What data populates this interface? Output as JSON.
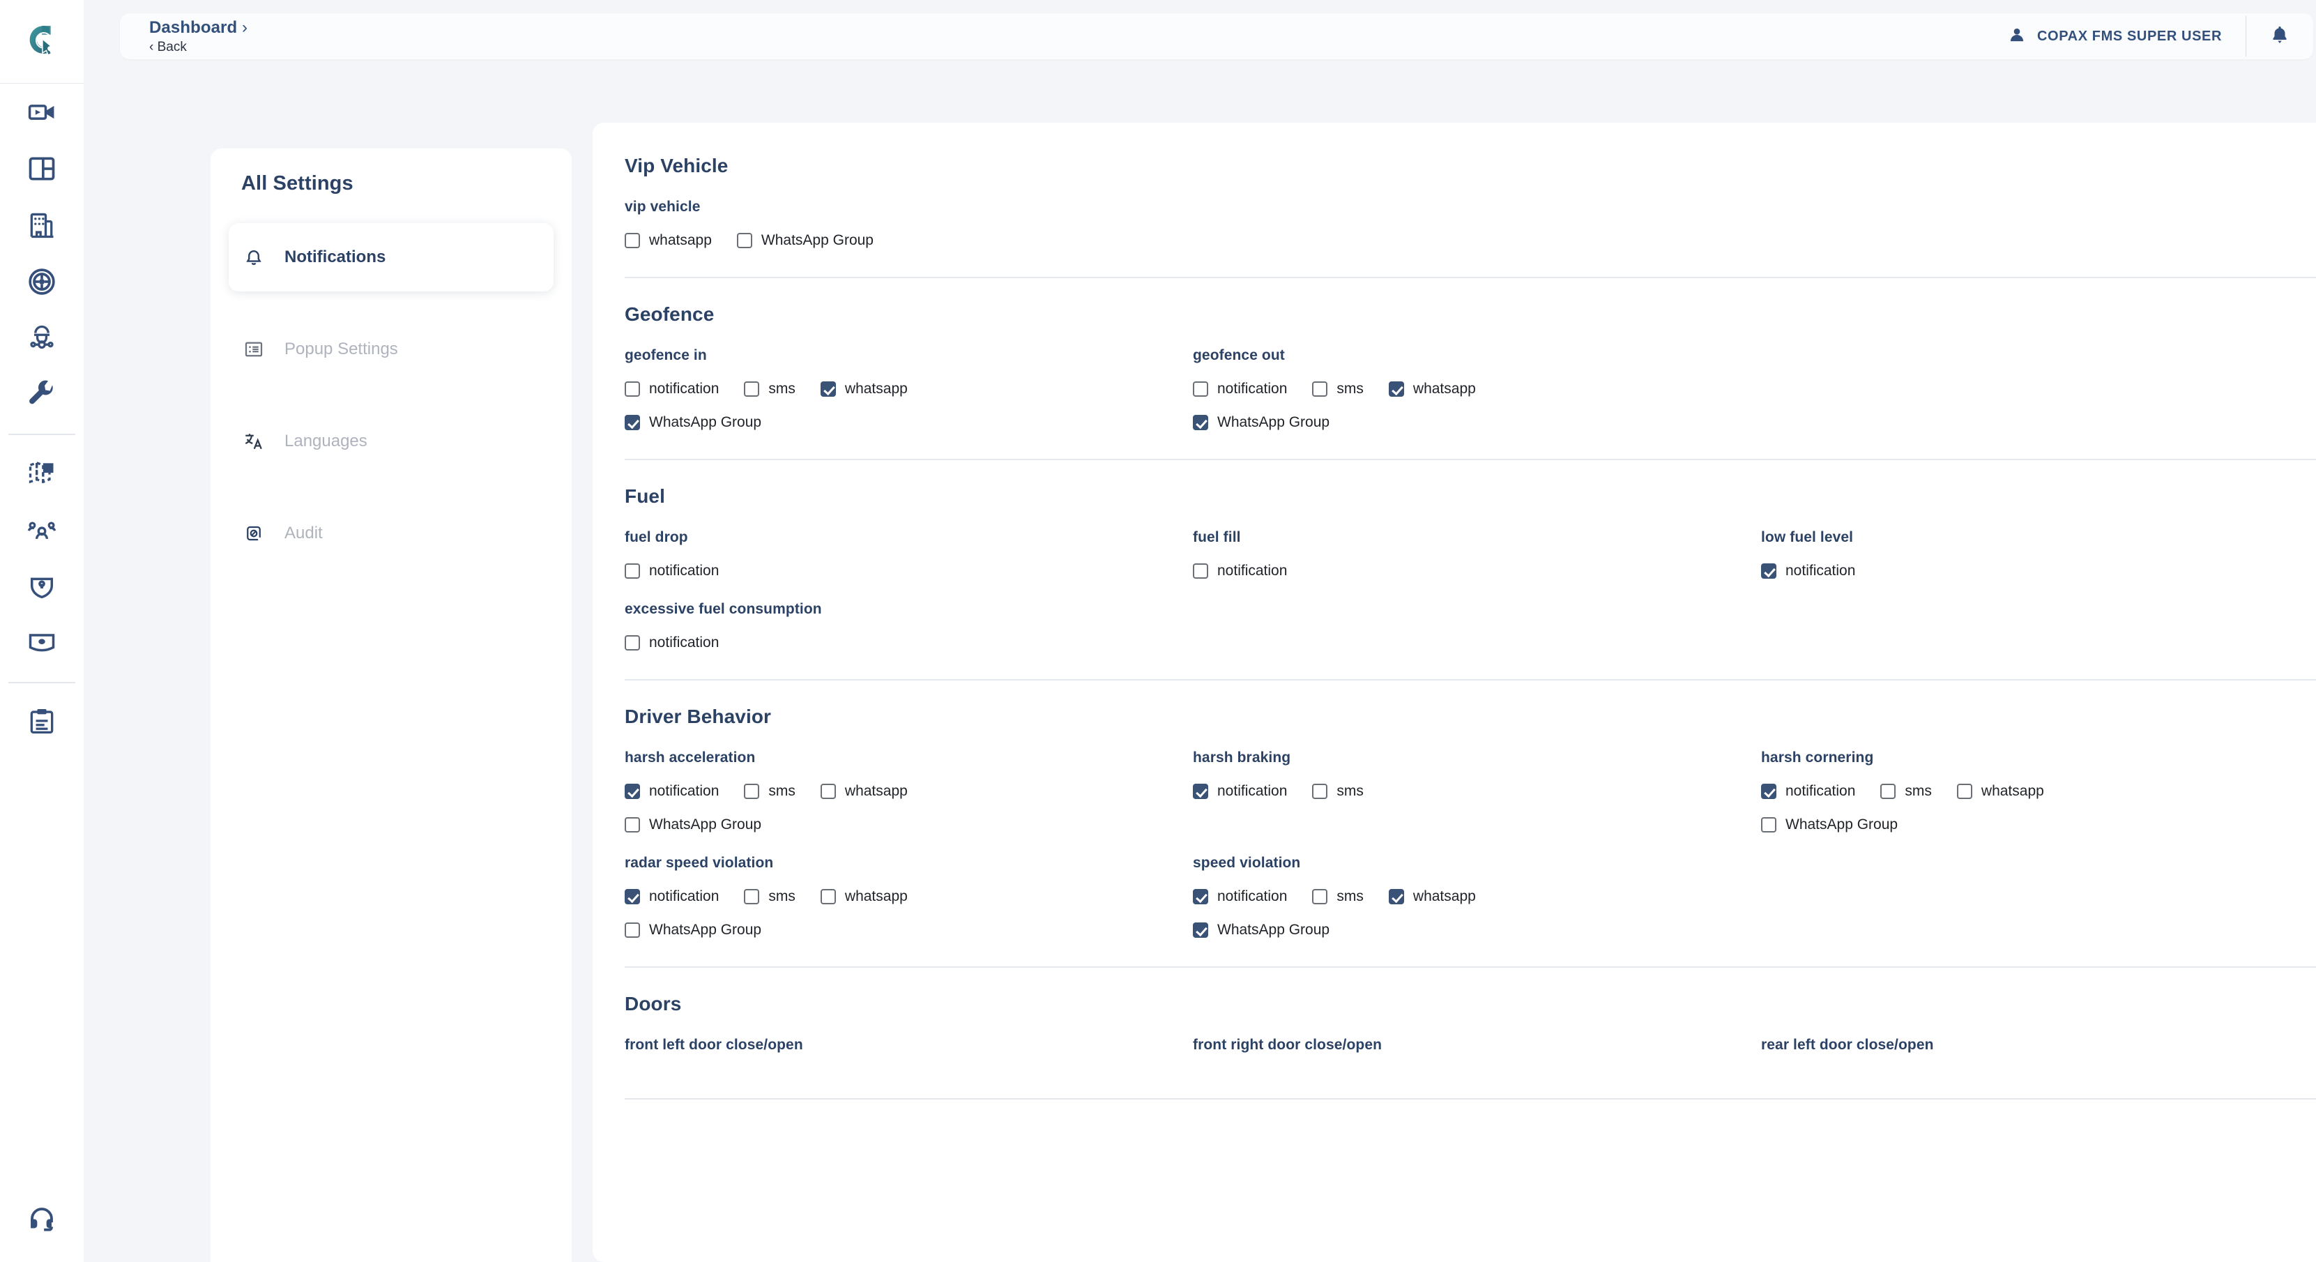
{
  "colors": {
    "accent_navy": "#2c4265",
    "checkbox_on": "#3a5275",
    "checkbox_border": "#6a6f76",
    "page_bg": "#f3f5f8",
    "muted_text": "#aeb3bd"
  },
  "rail": {
    "logo_icon": "copax-logo-icon",
    "groups": [
      [
        {
          "icon": "video-camera-icon",
          "name": "rail-item-live-video"
        },
        {
          "icon": "dashboard-layout-icon",
          "name": "rail-item-dashboard"
        },
        {
          "icon": "building-icon",
          "name": "rail-item-company"
        },
        {
          "icon": "tire-wheel-icon",
          "name": "rail-item-vehicles"
        },
        {
          "icon": "driver-icon",
          "name": "rail-item-drivers"
        },
        {
          "icon": "wrench-icon",
          "name": "rail-item-maintenance"
        }
      ],
      [
        {
          "icon": "map-icon",
          "name": "rail-item-map"
        },
        {
          "icon": "users-group-icon",
          "name": "rail-item-users"
        },
        {
          "icon": "shield-lock-icon",
          "name": "rail-item-security"
        },
        {
          "icon": "id-card-icon",
          "name": "rail-item-profiles"
        }
      ],
      [
        {
          "icon": "clipboard-icon",
          "name": "rail-item-reports"
        }
      ]
    ],
    "bottom": {
      "icon": "headset-support-icon",
      "name": "rail-item-support"
    }
  },
  "header": {
    "breadcrumb": "Dashboard",
    "breadcrumb_chevron": "›",
    "back_label": "‹ Back",
    "user_icon": "person-icon",
    "user_name": "COPAX FMS SUPER USER",
    "bell_icon": "bell-icon"
  },
  "settings_panel": {
    "title": "All Settings",
    "items": [
      {
        "label": "Notifications",
        "icon": "bell-icon",
        "active": true
      },
      {
        "label": "Popup Settings",
        "icon": "list-box-icon",
        "active": false
      },
      {
        "label": "Languages",
        "icon": "translate-icon",
        "active": false
      },
      {
        "label": "Audit",
        "icon": "audit-doc-icon",
        "active": false
      }
    ]
  },
  "sections": [
    {
      "title": "Vip Vehicle",
      "fields": [
        {
          "title": "vip vehicle",
          "row1": [
            {
              "label": "whatsapp",
              "checked": false
            },
            {
              "label": "WhatsApp Group",
              "checked": false
            }
          ],
          "row2": []
        }
      ]
    },
    {
      "title": "Geofence",
      "fields": [
        {
          "title": "geofence in",
          "row1": [
            {
              "label": "notification",
              "checked": false
            },
            {
              "label": "sms",
              "checked": false
            },
            {
              "label": "whatsapp",
              "checked": true
            }
          ],
          "row2": [
            {
              "label": "WhatsApp Group",
              "checked": true
            }
          ]
        },
        {
          "title": "geofence out",
          "row1": [
            {
              "label": "notification",
              "checked": false
            },
            {
              "label": "sms",
              "checked": false
            },
            {
              "label": "whatsapp",
              "checked": true
            }
          ],
          "row2": [
            {
              "label": "WhatsApp Group",
              "checked": true
            }
          ]
        }
      ]
    },
    {
      "title": "Fuel",
      "fields": [
        {
          "title": "fuel drop",
          "row1": [
            {
              "label": "notification",
              "checked": false
            }
          ],
          "row2": []
        },
        {
          "title": "fuel fill",
          "row1": [
            {
              "label": "notification",
              "checked": false
            }
          ],
          "row2": []
        },
        {
          "title": "low fuel level",
          "row1": [
            {
              "label": "notification",
              "checked": true
            }
          ],
          "row2": []
        },
        {
          "title": "excessive fuel consumption",
          "row1": [
            {
              "label": "notification",
              "checked": false
            }
          ],
          "row2": []
        }
      ]
    },
    {
      "title": "Driver Behavior",
      "fields": [
        {
          "title": "harsh acceleration",
          "row1": [
            {
              "label": "notification",
              "checked": true
            },
            {
              "label": "sms",
              "checked": false
            },
            {
              "label": "whatsapp",
              "checked": false
            }
          ],
          "row2": [
            {
              "label": "WhatsApp Group",
              "checked": false
            }
          ]
        },
        {
          "title": "harsh braking",
          "row1": [
            {
              "label": "notification",
              "checked": true
            },
            {
              "label": "sms",
              "checked": false
            }
          ],
          "row2": []
        },
        {
          "title": "harsh cornering",
          "row1": [
            {
              "label": "notification",
              "checked": true
            },
            {
              "label": "sms",
              "checked": false
            },
            {
              "label": "whatsapp",
              "checked": false
            }
          ],
          "row2": [
            {
              "label": "WhatsApp Group",
              "checked": false
            }
          ]
        },
        {
          "title": "radar speed violation",
          "row1": [
            {
              "label": "notification",
              "checked": true
            },
            {
              "label": "sms",
              "checked": false
            },
            {
              "label": "whatsapp",
              "checked": false
            }
          ],
          "row2": [
            {
              "label": "WhatsApp Group",
              "checked": false
            }
          ]
        },
        {
          "title": "speed violation",
          "row1": [
            {
              "label": "notification",
              "checked": true
            },
            {
              "label": "sms",
              "checked": false
            },
            {
              "label": "whatsapp",
              "checked": true
            }
          ],
          "row2": [
            {
              "label": "WhatsApp Group",
              "checked": true
            }
          ]
        }
      ]
    },
    {
      "title": "Doors",
      "fields": [
        {
          "title": "front left door close/open",
          "row1": [],
          "row2": []
        },
        {
          "title": "front right door close/open",
          "row1": [],
          "row2": []
        },
        {
          "title": "rear left door close/open",
          "row1": [],
          "row2": []
        }
      ]
    }
  ]
}
